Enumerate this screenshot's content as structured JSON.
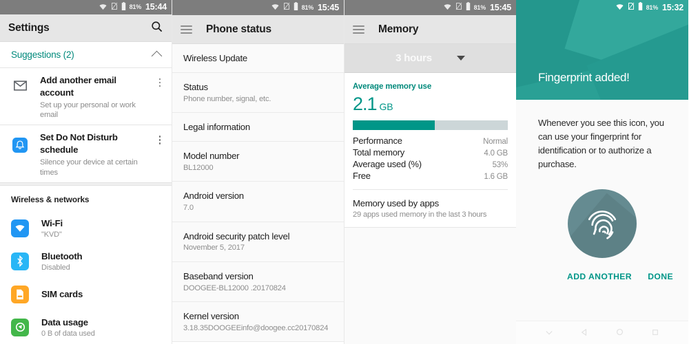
{
  "panels": {
    "settings": {
      "statusbar": {
        "battery_percent": "81%",
        "time": "15:44",
        "wifi_icon": "wifi-icon",
        "sim_icon": "sim-off-icon",
        "battery_icon": "battery-icon"
      },
      "appbar": {
        "title": "Settings",
        "search_icon": "search-icon"
      },
      "suggestions": {
        "title": "Suggestions (2)",
        "collapse_icon": "chevron-up-icon",
        "items": [
          {
            "icon": "gmail-icon",
            "title": "Add another email account",
            "subtitle": "Set up your personal or work email",
            "menu_icon": "overflow-menu-icon"
          },
          {
            "icon": "bell-icon",
            "title": "Set Do Not Disturb schedule",
            "subtitle": "Silence your device at certain times",
            "menu_icon": "overflow-menu-icon"
          }
        ]
      },
      "section_title": "Wireless & networks",
      "items": [
        {
          "icon": "wifi-settings-icon",
          "title": "Wi-Fi",
          "subtitle": "\"KVD\"",
          "color": "#2196f3"
        },
        {
          "icon": "bluetooth-icon",
          "title": "Bluetooth",
          "subtitle": "Disabled",
          "color": "#29b6f6"
        },
        {
          "icon": "sim-cards-icon",
          "title": "SIM cards",
          "subtitle": "",
          "color": "#ffa726"
        },
        {
          "icon": "data-usage-icon",
          "title": "Data usage",
          "subtitle": "0 B of data used",
          "color": "#43b74a"
        }
      ]
    },
    "phone_status": {
      "statusbar": {
        "battery_percent": "81%",
        "time": "15:45",
        "wifi_icon": "wifi-icon",
        "sim_icon": "sim-off-icon",
        "battery_icon": "battery-icon"
      },
      "appbar": {
        "title": "Phone status",
        "menu_icon": "hamburger-icon"
      },
      "items": [
        {
          "title": "Wireless Update",
          "subtitle": ""
        },
        {
          "title": "Status",
          "subtitle": "Phone number, signal, etc."
        },
        {
          "title": "Legal information",
          "subtitle": ""
        },
        {
          "title": "Model number",
          "subtitle": "BL12000"
        },
        {
          "title": "Android version",
          "subtitle": "7.0"
        },
        {
          "title": "Android security patch level",
          "subtitle": "November 5, 2017"
        },
        {
          "title": "Baseband version",
          "subtitle": "DOOGEE-BL12000 .20170824"
        },
        {
          "title": "Kernel version",
          "subtitle": "3.18.35DOOGEEinfo@doogee.cc20170824"
        }
      ]
    },
    "memory": {
      "statusbar": {
        "battery_percent": "81%",
        "time": "15:45",
        "wifi_icon": "wifi-icon",
        "sim_icon": "sim-off-icon",
        "battery_icon": "battery-icon"
      },
      "appbar": {
        "title": "Memory",
        "menu_icon": "hamburger-icon"
      },
      "range": {
        "label": "3 hours",
        "dropdown_icon": "caret-down-icon"
      },
      "caption": "Average memory use",
      "value": "2.1",
      "unit": "GB",
      "bar_percent": 53,
      "accent_color": "#009688",
      "stats": [
        {
          "key": "Performance",
          "value": "Normal"
        },
        {
          "key": "Total memory",
          "value": "4.0 GB"
        },
        {
          "key": "Average used (%)",
          "value": "53%"
        },
        {
          "key": "Free",
          "value": "1.6 GB"
        }
      ],
      "apps": {
        "title": "Memory used by apps",
        "subtitle": "29 apps used memory in the last 3 hours"
      }
    },
    "fingerprint": {
      "statusbar": {
        "battery_percent": "81%",
        "time": "15:32",
        "wifi_icon": "wifi-icon",
        "sim_icon": "sim-off-icon",
        "battery_icon": "battery-icon"
      },
      "hero_title": "Fingerprint added!",
      "hero_color": "#2aa095",
      "description": "Whenever you see this icon, you can use your fingerprint for identification or to authorize a purchase.",
      "fingerprint_icon": "fingerprint-icon",
      "buttons": {
        "add_another": "ADD ANOTHER",
        "done": "DONE"
      },
      "navbar": {
        "collapse_icon": "caret-down-icon",
        "back_icon": "back-triangle-icon",
        "home_icon": "home-circle-icon",
        "recents_icon": "recents-square-icon"
      }
    }
  }
}
